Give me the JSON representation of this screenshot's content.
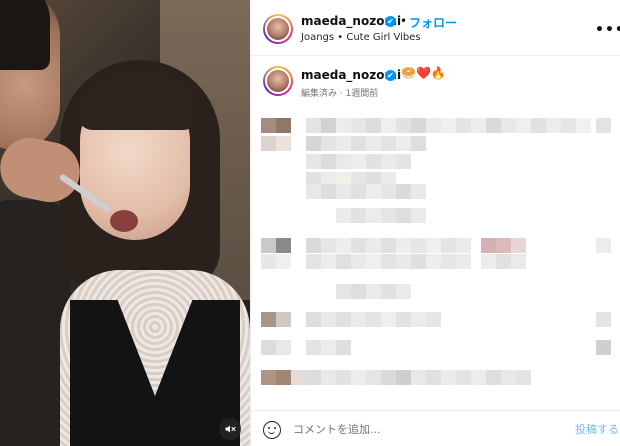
{
  "post": {
    "author": {
      "username": "maeda_nozomi",
      "verified_mark": "✔",
      "separator": "•",
      "follow_label": "フォロー",
      "audio_subtitle": "Joangs • Cute Girl Vibes"
    },
    "more_label": "•••",
    "caption": {
      "username": "maeda_nozomi",
      "emojis": "🥯❤️🔥",
      "meta": "編集済み · 1週間前"
    },
    "composer": {
      "placeholder": "コメントを追加...",
      "post_label": "投稿する"
    },
    "media": {
      "mute_icon": "speaker-muted-icon"
    },
    "colors": {
      "accent": "#0095f6",
      "post_disabled": "#7ab8f0",
      "muted_text": "#737373"
    }
  }
}
